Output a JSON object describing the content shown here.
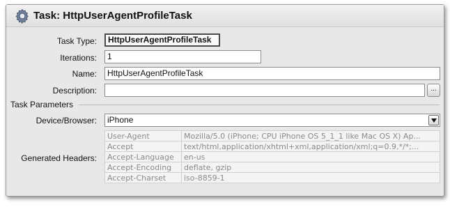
{
  "window": {
    "title": "Task: HttpUserAgentProfileTask",
    "icon": "gear-icon"
  },
  "form": {
    "task_type_label": "Task Type:",
    "task_type_value": "HttpUserAgentProfileTask",
    "iterations_label": "Iterations:",
    "iterations_value": "1",
    "name_label": "Name:",
    "name_value": "HttpUserAgentProfileTask",
    "description_label": "Description:",
    "description_value": "",
    "description_button": "..."
  },
  "task_parameters": {
    "section_label": "Task Parameters",
    "device_label": "Device/Browser:",
    "device_value": "iPhone",
    "generated_headers_label": "Generated Headers:",
    "headers": [
      {
        "key": "User-Agent",
        "value": "Mozilla/5.0 (iPhone; CPU iPhone OS 5_1_1 like Mac OS X) Ap..."
      },
      {
        "key": "Accept",
        "value": "text/html,application/xhtml+xml,application/xml;q=0.9,*/*;..."
      },
      {
        "key": "Accept-Language",
        "value": "en-us"
      },
      {
        "key": "Accept-Encoding",
        "value": "deflate, gzip"
      },
      {
        "key": "Accept-Charset",
        "value": "iso-8859-1"
      }
    ]
  }
}
